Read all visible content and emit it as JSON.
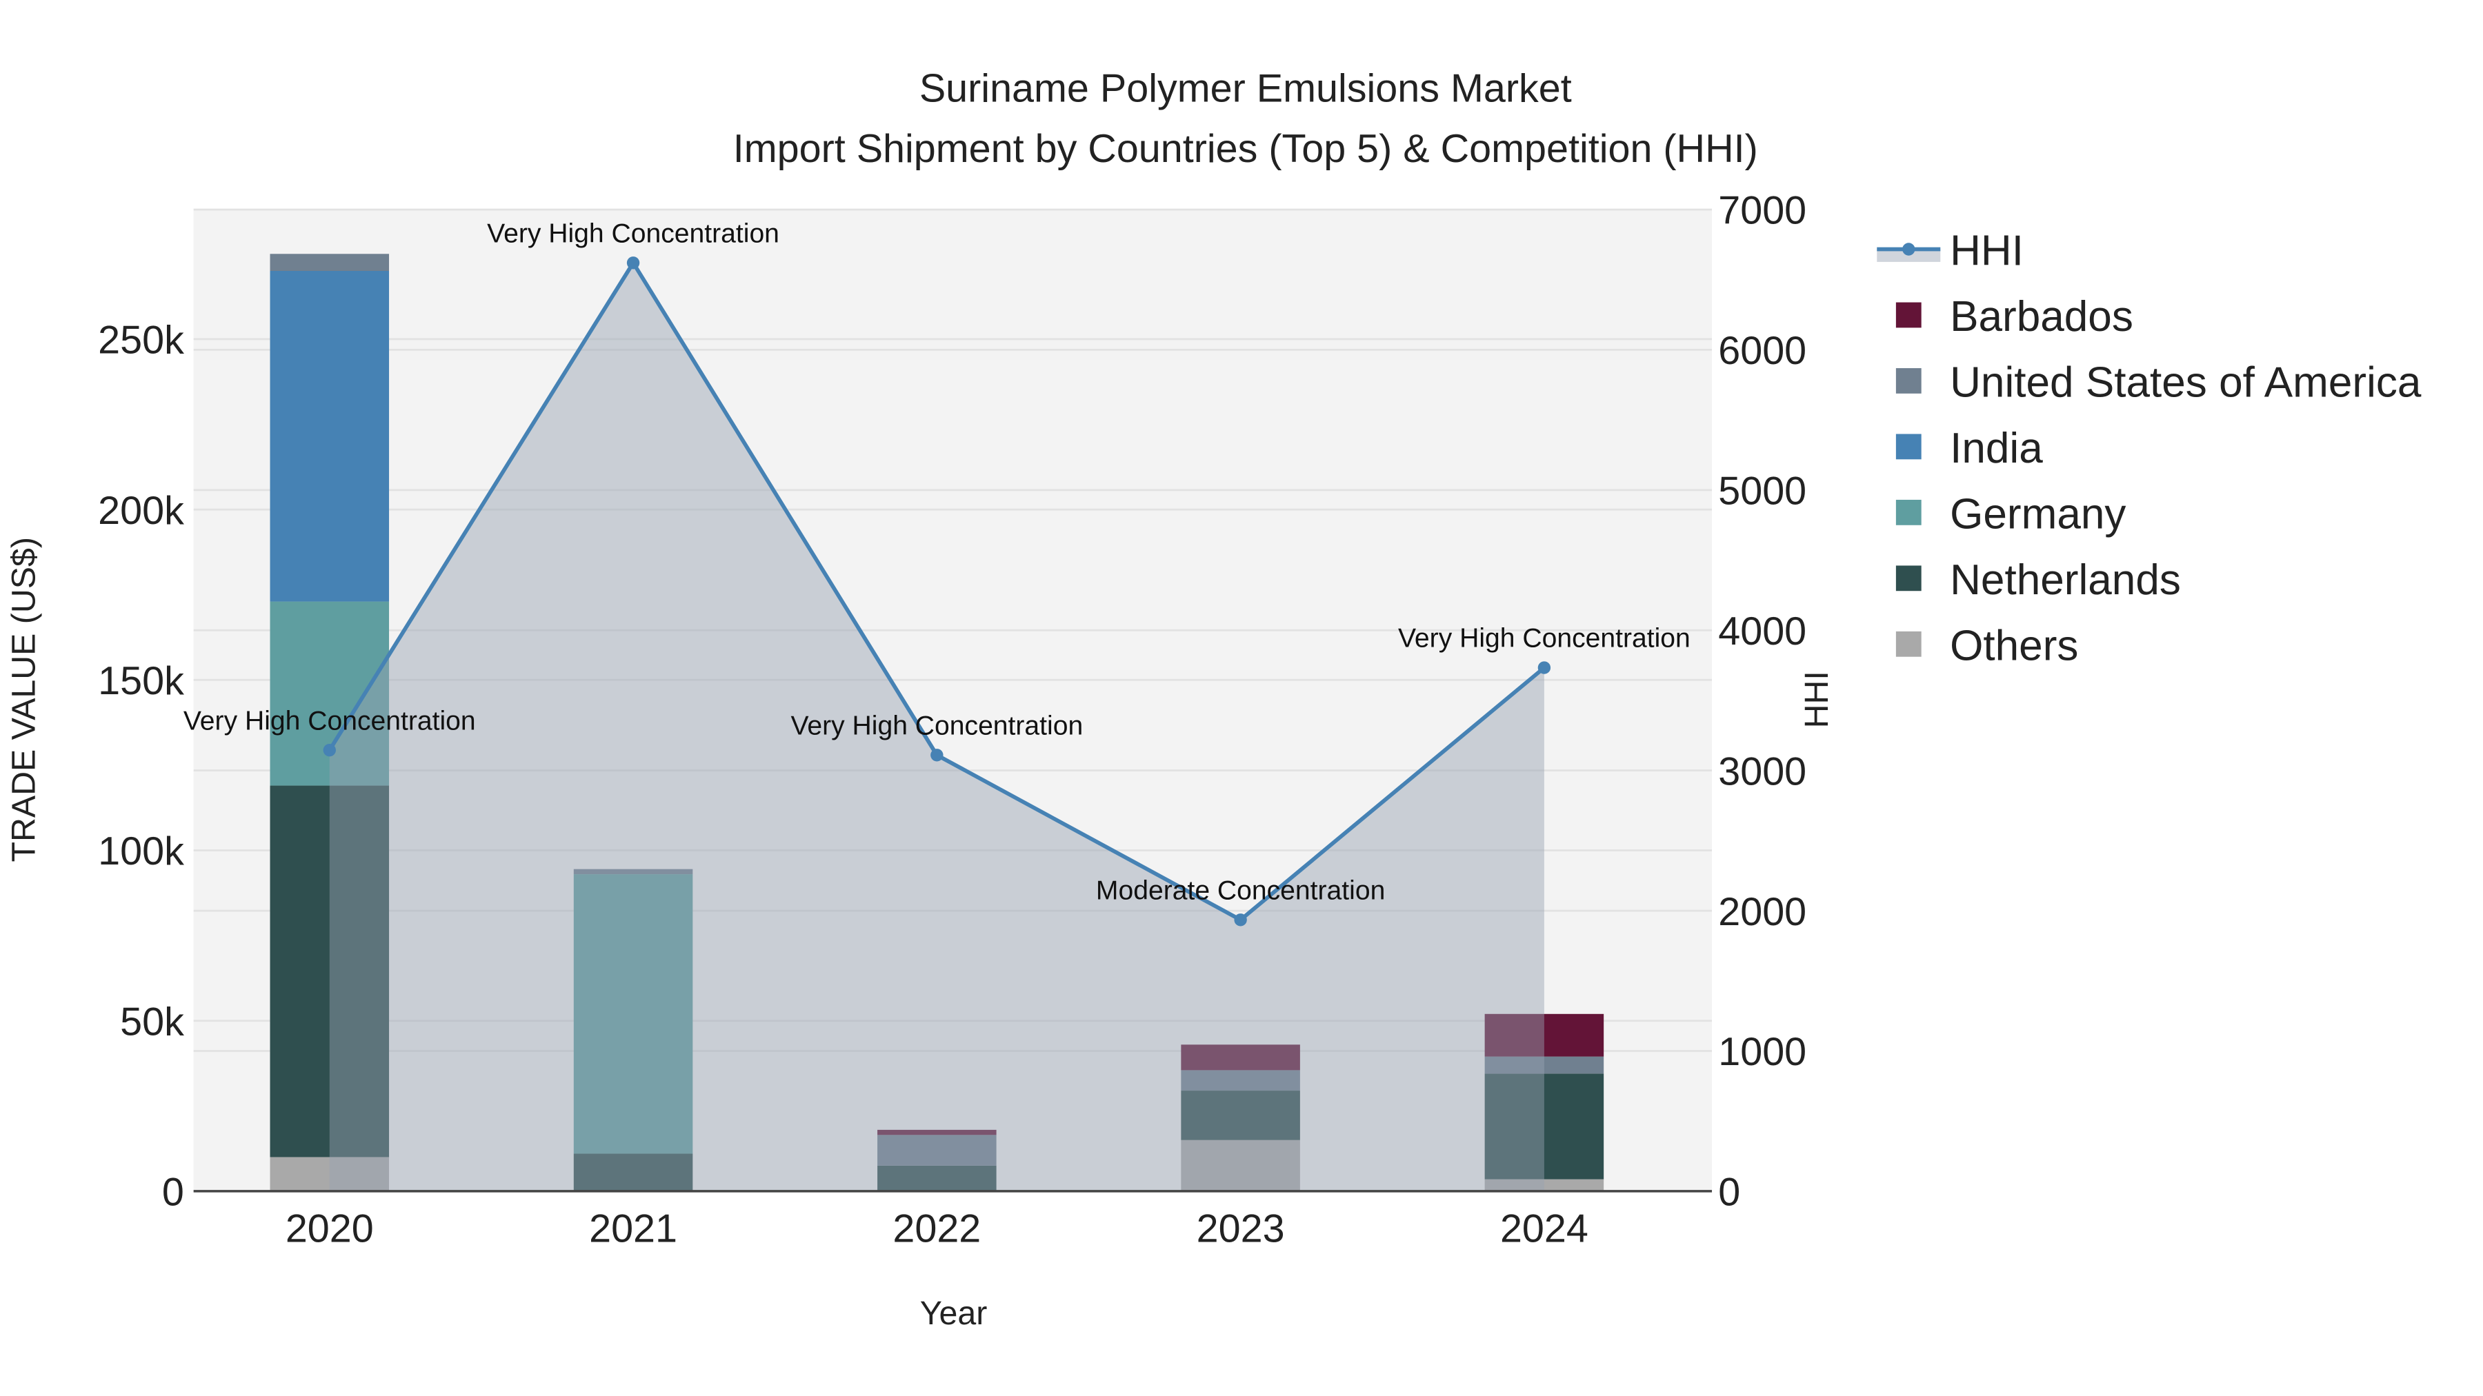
{
  "chart_data": {
    "type": "bar",
    "title": "Suriname Polymer Emulsions Market",
    "subtitle": "Import Shipment by Countries (Top 5) & Competition (HHI)",
    "xlabel": "Year",
    "ylabel": "TRADE VALUE (US$)",
    "y2label": "HHI",
    "categories": [
      "2020",
      "2021",
      "2022",
      "2023",
      "2024"
    ],
    "ylim": [
      0,
      288000
    ],
    "y2lim": [
      0,
      7000
    ],
    "yticks": [
      0,
      50000,
      100000,
      150000,
      200000,
      250000
    ],
    "ytick_labels": [
      "0",
      "50k",
      "100k",
      "150k",
      "200k",
      "250k"
    ],
    "y2ticks": [
      0,
      1000,
      2000,
      3000,
      4000,
      5000,
      6000,
      7000
    ],
    "y2tick_labels": [
      "0",
      "1000",
      "2000",
      "3000",
      "4000",
      "5000",
      "6000",
      "7000"
    ],
    "stacked": true,
    "series": [
      {
        "name": "Others",
        "color": "#a9a9a9",
        "values": [
          10000,
          0,
          0,
          15000,
          3500
        ]
      },
      {
        "name": "Netherlands",
        "color": "#2f4f4f",
        "values": [
          109000,
          11000,
          7500,
          14500,
          31000
        ]
      },
      {
        "name": "Germany",
        "color": "#5f9ea0",
        "values": [
          54000,
          82000,
          0,
          0,
          0
        ]
      },
      {
        "name": "India",
        "color": "#4682b4",
        "values": [
          97000,
          0,
          0,
          0,
          0
        ]
      },
      {
        "name": "United States of America",
        "color": "#708090",
        "values": [
          5000,
          1500,
          9000,
          6000,
          5000
        ]
      },
      {
        "name": "Barbados",
        "color": "#631437",
        "values": [
          0,
          0,
          1500,
          7500,
          12500
        ]
      }
    ],
    "hhi": {
      "name": "HHI",
      "color": "#4682b4",
      "values": [
        3145,
        6620,
        3110,
        1935,
        3733
      ],
      "annotations": [
        "Very High Concentration",
        "Very High Concentration",
        "Very High Concentration",
        "Moderate Concentration",
        "Very High Concentration"
      ]
    },
    "legend_order": [
      "HHI",
      "Barbados",
      "United States of America",
      "India",
      "Germany",
      "Netherlands",
      "Others"
    ],
    "legend_placement": "right",
    "grid": true
  }
}
